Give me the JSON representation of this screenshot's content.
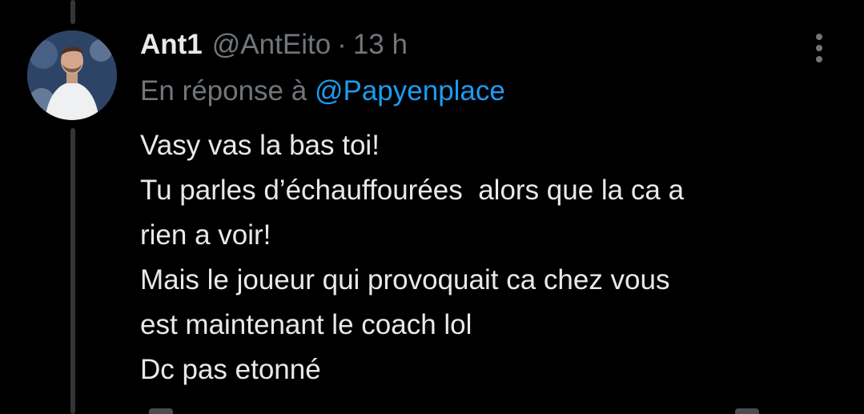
{
  "thread": {
    "author": {
      "display_name": "Ant1",
      "handle": "@AntEito",
      "avatar": "profile-photo-man-white-shirt"
    },
    "separator": "·",
    "time": "13 h",
    "reply_prefix": "En réponse à",
    "reply_to": "@Papyenplace",
    "text_lines": [
      "Vasy vas la bas toi!",
      "Tu parles d’échauffourées  alors que la ca a",
      "rien a voir!",
      "Mais le joueur qui provoquait ca chez vous",
      "est maintenant le coach lol",
      "Dc pas etonné"
    ],
    "more_icon": "more-vertical-icon"
  },
  "colors": {
    "background": "#000000",
    "text": "#e7e9ea",
    "secondary": "#71767b",
    "link": "#1d9bf0",
    "thread_line": "#333639"
  }
}
